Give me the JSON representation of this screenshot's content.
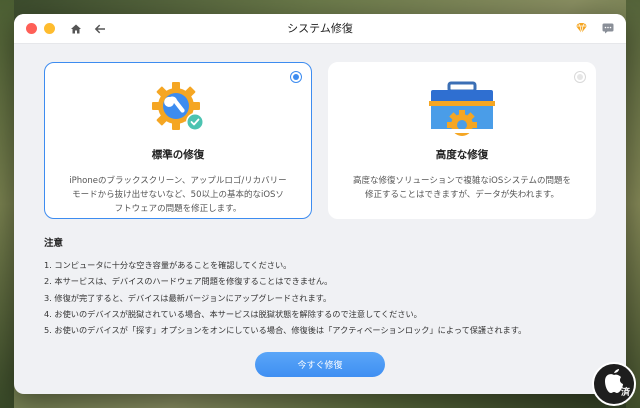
{
  "window": {
    "title": "システム修復"
  },
  "cards": [
    {
      "title": "標準の修復",
      "description": "iPhoneのブラックスクリーン、アップルロゴ/リカバリーモードから抜け出せないなど、50以上の基本的なiOSソフトウェアの問題を修正します。",
      "selected": true,
      "icon": "gear-wrench-check-icon"
    },
    {
      "title": "高度な修復",
      "description": "高度な修復ソリューションで複雑なiOSシステムの問題を修正することはできますが、データが失われます。",
      "selected": false,
      "icon": "toolbox-gear-icon"
    }
  ],
  "notes": {
    "title": "注意",
    "items": [
      "1. コンピュータに十分な空き容量があることを確認してください。",
      "2. 本サービスは、デバイスのハードウェア問題を修復することはできません。",
      "3. 修復が完了すると、デバイスは最新バージョンにアップグレードされます。",
      "4. お使いのデバイスが脱獄されている場合、本サービスは脱獄状態を解除するので注意してください。",
      "5. お使いのデバイスが「探す」オプションをオンにしている場合、修復後は「アクティベーションロック」によって保護されます。"
    ]
  },
  "button": {
    "label": "今すぐ修復"
  },
  "watermark": {
    "text": "済"
  },
  "colors": {
    "accent": "#3d8cf0",
    "gear": "#f5a623",
    "toolbox": "#4a9de8"
  }
}
